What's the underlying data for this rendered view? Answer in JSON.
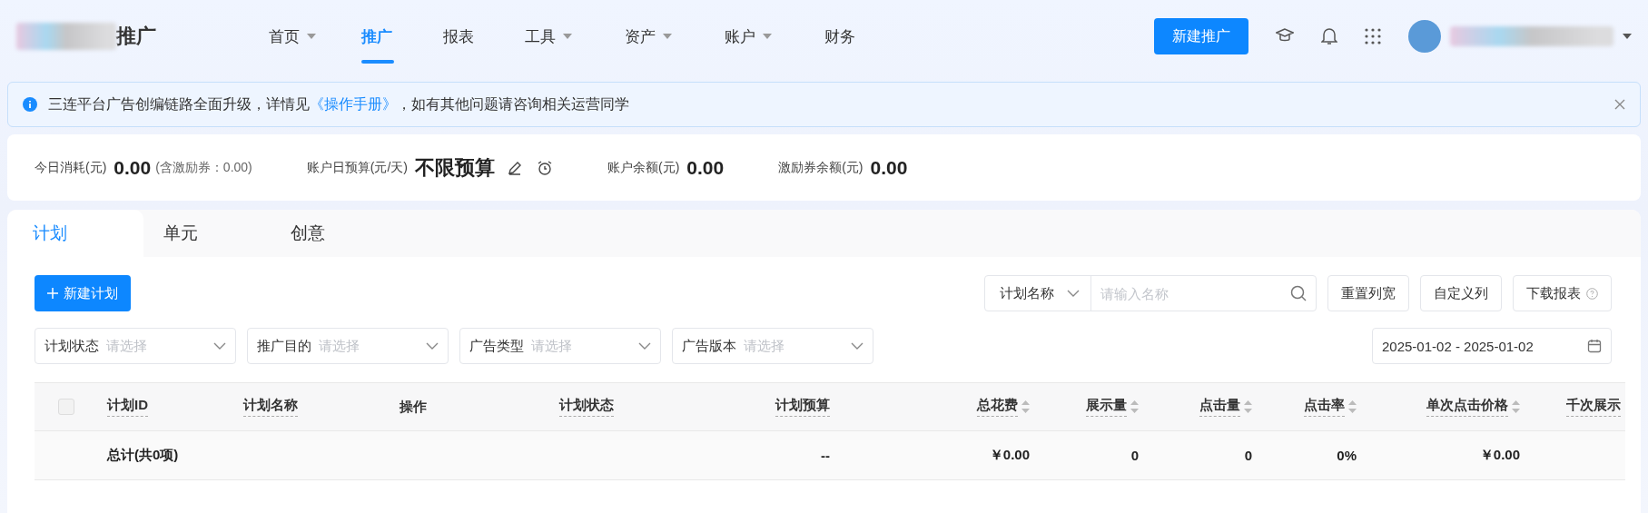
{
  "header": {
    "logo_text": "推广",
    "nav": [
      {
        "label": "首页",
        "dropdown": true,
        "selected": false
      },
      {
        "label": "推广",
        "dropdown": false,
        "selected": true
      },
      {
        "label": "报表",
        "dropdown": false,
        "selected": false
      },
      {
        "label": "工具",
        "dropdown": true,
        "selected": false
      },
      {
        "label": "资产",
        "dropdown": true,
        "selected": false
      },
      {
        "label": "账户",
        "dropdown": true,
        "selected": false
      },
      {
        "label": "财务",
        "dropdown": false,
        "selected": false
      }
    ],
    "create_button": "新建推广"
  },
  "notice": {
    "parts": [
      {
        "kind": "text",
        "text": "三连平台广告创编链路全面升级，详情见"
      },
      {
        "kind": "link",
        "text": "《操作手册》"
      },
      {
        "kind": "text",
        "text": "，如有其他问题请咨询相关运营同学"
      }
    ]
  },
  "stats": [
    {
      "kind": "plain",
      "label": "今日消耗(元)",
      "value": "0.00",
      "note": "(含激励券：0.00)"
    },
    {
      "kind": "budget",
      "label": "账户日预算(元/天)",
      "value": "不限预算"
    },
    {
      "kind": "plain",
      "label": "账户余额(元)",
      "value": "0.00"
    },
    {
      "kind": "plain",
      "label": "激励券余额(元)",
      "value": "0.00"
    }
  ],
  "tabs": [
    {
      "label": "计划",
      "selected": true
    },
    {
      "label": "单元",
      "selected": false
    },
    {
      "label": "创意",
      "selected": false
    }
  ],
  "toolbar": {
    "new_button": "新建计划",
    "search_field": {
      "select": "计划名称",
      "placeholder": "请输入名称"
    },
    "buttons": [
      {
        "label": "重置列宽",
        "help": false
      },
      {
        "label": "自定义列",
        "help": false
      },
      {
        "label": "下载报表",
        "help": true
      }
    ]
  },
  "filters": [
    {
      "label": "计划状态",
      "placeholder": "请选择"
    },
    {
      "label": "推广目的",
      "placeholder": "请选择"
    },
    {
      "label": "广告类型",
      "placeholder": "请选择"
    },
    {
      "label": "广告版本",
      "placeholder": "请选择"
    }
  ],
  "date_range": "2025-01-02 - 2025-01-02",
  "table": {
    "select_all_checked": false,
    "columns": [
      {
        "label": "计划ID",
        "kind": "text",
        "sortable": false,
        "total": "总计(共0项)"
      },
      {
        "label": "计划名称",
        "kind": "text",
        "sortable": false
      },
      {
        "label": "操作",
        "kind": "plain",
        "sortable": false
      },
      {
        "label": "计划状态",
        "kind": "text",
        "sortable": false
      },
      {
        "label": "计划预算",
        "kind": "metric",
        "sortable": false,
        "total": "--"
      },
      {
        "label": "总花费",
        "kind": "metric",
        "sortable": true,
        "total": "￥0.00"
      },
      {
        "label": "展示量",
        "kind": "metric",
        "sortable": true,
        "total": "0"
      },
      {
        "label": "点击量",
        "kind": "metric",
        "sortable": true,
        "total": "0"
      },
      {
        "label": "点击率",
        "kind": "metric",
        "sortable": true,
        "total": "0%"
      },
      {
        "label": "单次点击价格",
        "kind": "metric",
        "sortable": true,
        "total": "￥0.00"
      },
      {
        "label": "千次展示",
        "kind": "cut",
        "sortable": false
      }
    ]
  }
}
